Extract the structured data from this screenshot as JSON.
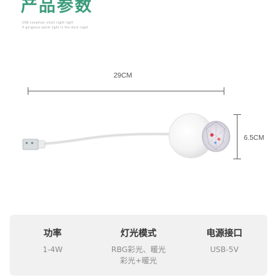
{
  "header": {
    "title": "产品参数",
    "subtitle_line1": "USB snowman small night light",
    "subtitle_line2": "A gorgeous warm light in the dark night"
  },
  "dimensions": {
    "length_label": "29CM",
    "height_label": "6.5CM"
  },
  "specs": [
    {
      "heading": "功率",
      "value_lines": [
        "1-4W"
      ]
    },
    {
      "heading": "灯光模式",
      "value_lines": [
        "RBG彩光、暖光",
        "彩光+暖光"
      ]
    },
    {
      "heading": "电源接口",
      "value_lines": [
        "USB-5V"
      ]
    }
  ]
}
